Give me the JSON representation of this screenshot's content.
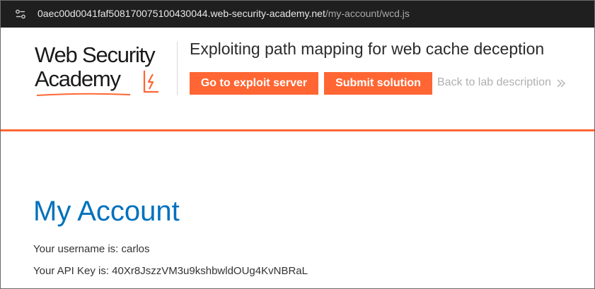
{
  "browser": {
    "url_host": "0aec00d0041faf508170075100430044.web-security-academy.net",
    "url_path": "/my-account/wcd.js",
    "site_info_icon": "site-settings-icon"
  },
  "lab_header": {
    "logo_line1": "Web Security",
    "logo_line2": "Academy",
    "title": "Exploiting path mapping for web cache deception",
    "exploit_button": "Go to exploit server",
    "submit_button": "Submit solution",
    "back_link": "Back to lab description",
    "accent_color": "#ff6633"
  },
  "main": {
    "page_title": "My Account",
    "username_line": "Your username is: carlos",
    "api_key_line": "Your API Key is: 40Xr8JszzVM3u9kshbwldOUg4KvNBRaL",
    "title_color": "#0071bc"
  }
}
